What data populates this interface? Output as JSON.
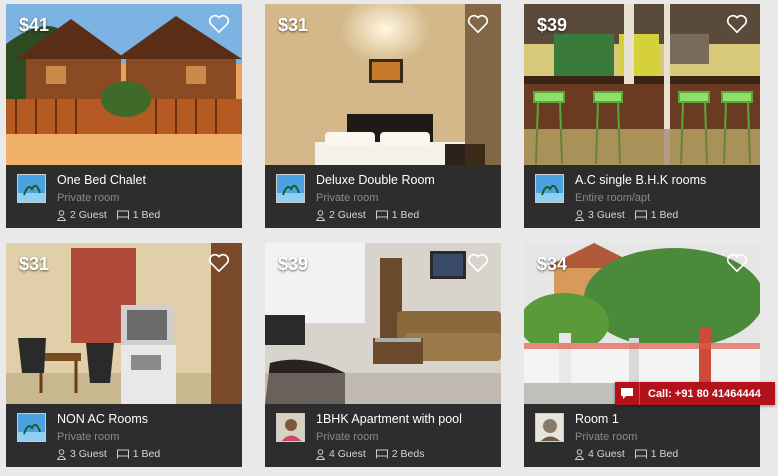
{
  "listings": [
    {
      "price": "$41",
      "title": "One Bed Chalet",
      "room_type": "Private room",
      "guests": "2 Guest",
      "beds": "1 Bed"
    },
    {
      "price": "$31",
      "title": "Deluxe Double Room",
      "room_type": "Private room",
      "guests": "2 Guest",
      "beds": "1 Bed"
    },
    {
      "price": "$39",
      "title": "A.C single B.H.K rooms",
      "room_type": "Entire room/apt",
      "guests": "3 Guest",
      "beds": "1 Bed"
    },
    {
      "price": "$31",
      "title": "NON AC Rooms",
      "room_type": "Private room",
      "guests": "3 Guest",
      "beds": "1 Bed"
    },
    {
      "price": "$39",
      "title": "1BHK Apartment with pool",
      "room_type": "Private room",
      "guests": "4 Guest",
      "beds": "2 Beds"
    },
    {
      "price": "$34",
      "title": "Room 1",
      "room_type": "Private room",
      "guests": "4 Guest",
      "beds": "1 Bed"
    }
  ],
  "call_button": {
    "label": "Call: +91 80 41464444",
    "icon": "chat-bubble-icon",
    "color": "#b3121b"
  },
  "icons": {
    "favorite": "heart-icon",
    "guests": "person-icon",
    "beds": "bed-icon"
  },
  "colors": {
    "card_bg": "#2d2d2d",
    "page_bg": "#e9e9e9",
    "muted_text": "#8a8a8a"
  }
}
